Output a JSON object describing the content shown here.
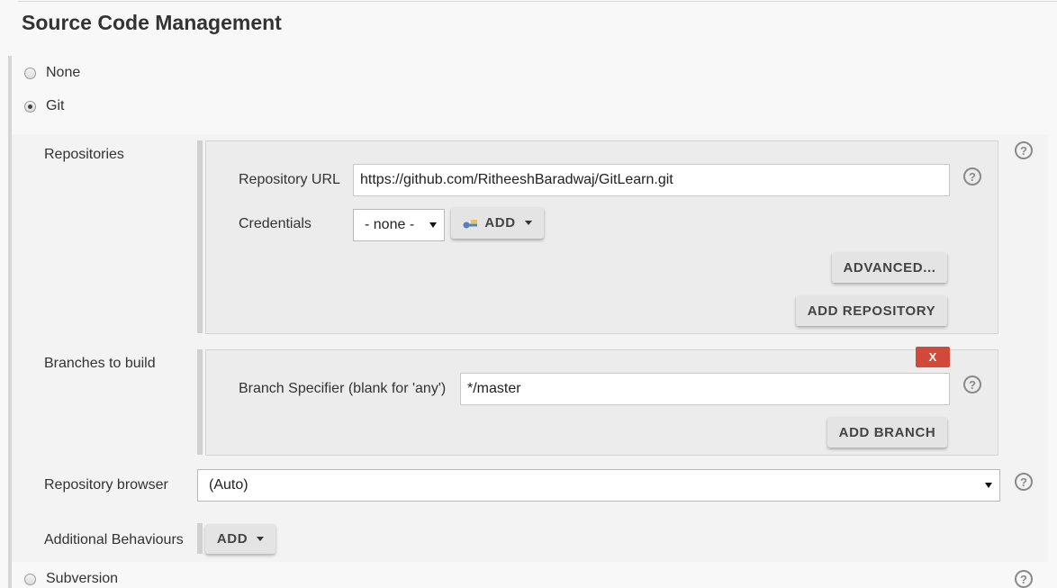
{
  "section": {
    "title": "Source Code Management"
  },
  "scm_options": {
    "none_label": "None",
    "git_label": "Git",
    "subversion_label": "Subversion",
    "selected": "Git"
  },
  "repositories": {
    "label": "Repositories",
    "url_label": "Repository URL",
    "url_value": "https://github.com/RitheeshBaradwaj/GitLearn.git",
    "credentials_label": "Credentials",
    "credentials_selected": "- none -",
    "add_label": "ADD",
    "advanced_label": "ADVANCED...",
    "add_repository_label": "ADD REPOSITORY"
  },
  "branches": {
    "label": "Branches to build",
    "delete_label": "X",
    "specifier_label": "Branch Specifier (blank for 'any')",
    "specifier_value": "*/master",
    "add_branch_label": "ADD BRANCH"
  },
  "repository_browser": {
    "label": "Repository browser",
    "selected": "(Auto)"
  },
  "additional_behaviours": {
    "label": "Additional Behaviours",
    "add_label": "ADD"
  },
  "help": {
    "glyph": "?"
  },
  "colors": {
    "delete_red": "#d24939",
    "key_blue": "#5a7fb5",
    "key_yellow": "#e8c44a"
  }
}
